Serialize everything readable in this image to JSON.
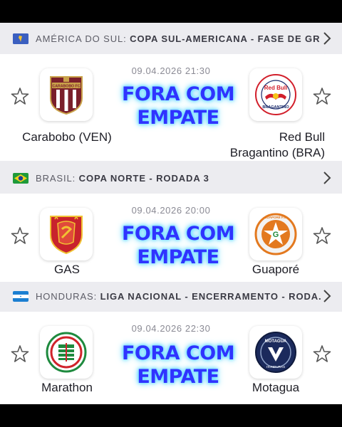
{
  "leagues": [
    {
      "country": "AMÉRICA DO SUL:",
      "competition": "COPA SUL-AMERICANA - FASE DE GR..."
    },
    {
      "country": "BRASIL:",
      "competition": "COPA NORTE - RODADA 3"
    },
    {
      "country": "HONDURAS:",
      "competition": "LIGA NACIONAL - ENCERRAMENTO - RODA..."
    }
  ],
  "matches": [
    {
      "time": "09.04.2026 21:30",
      "home": "Carabobo (VEN)",
      "away_line1": "Red Bull",
      "away_line2": "Bragantino (BRA)",
      "home_logo": "carabobo-logo",
      "away_logo": "red-bull-bragantino-logo",
      "overlay_line1": "FORA COM",
      "overlay_line2": "EMPATE"
    },
    {
      "time": "09.04.2026 20:00",
      "home": "GAS",
      "away": "Guaporé",
      "home_logo": "gas-logo",
      "away_logo": "guapore-logo",
      "overlay_line1": "FORA COM",
      "overlay_line2": "EMPATE"
    },
    {
      "time": "09.04.2026 22:30",
      "home": "Marathon",
      "away": "Motagua",
      "home_logo": "marathon-logo",
      "away_logo": "motagua-logo",
      "overlay_line1": "FORA COM",
      "overlay_line2": "EMPATE"
    }
  ],
  "logo_text": {
    "carabobo": "CARABOBO FC",
    "redbull": "Red Bull",
    "bragantino": "BRAGANTINO",
    "guapore": "GUAPORÉ F.C.",
    "motagua": "MOTAGUA",
    "honduras": "HONDURAS"
  },
  "colors": {
    "overlay_text": "#2f33ff",
    "overlay_glow": "#49cfff",
    "background": "#ececf0",
    "card": "#ffffff"
  }
}
